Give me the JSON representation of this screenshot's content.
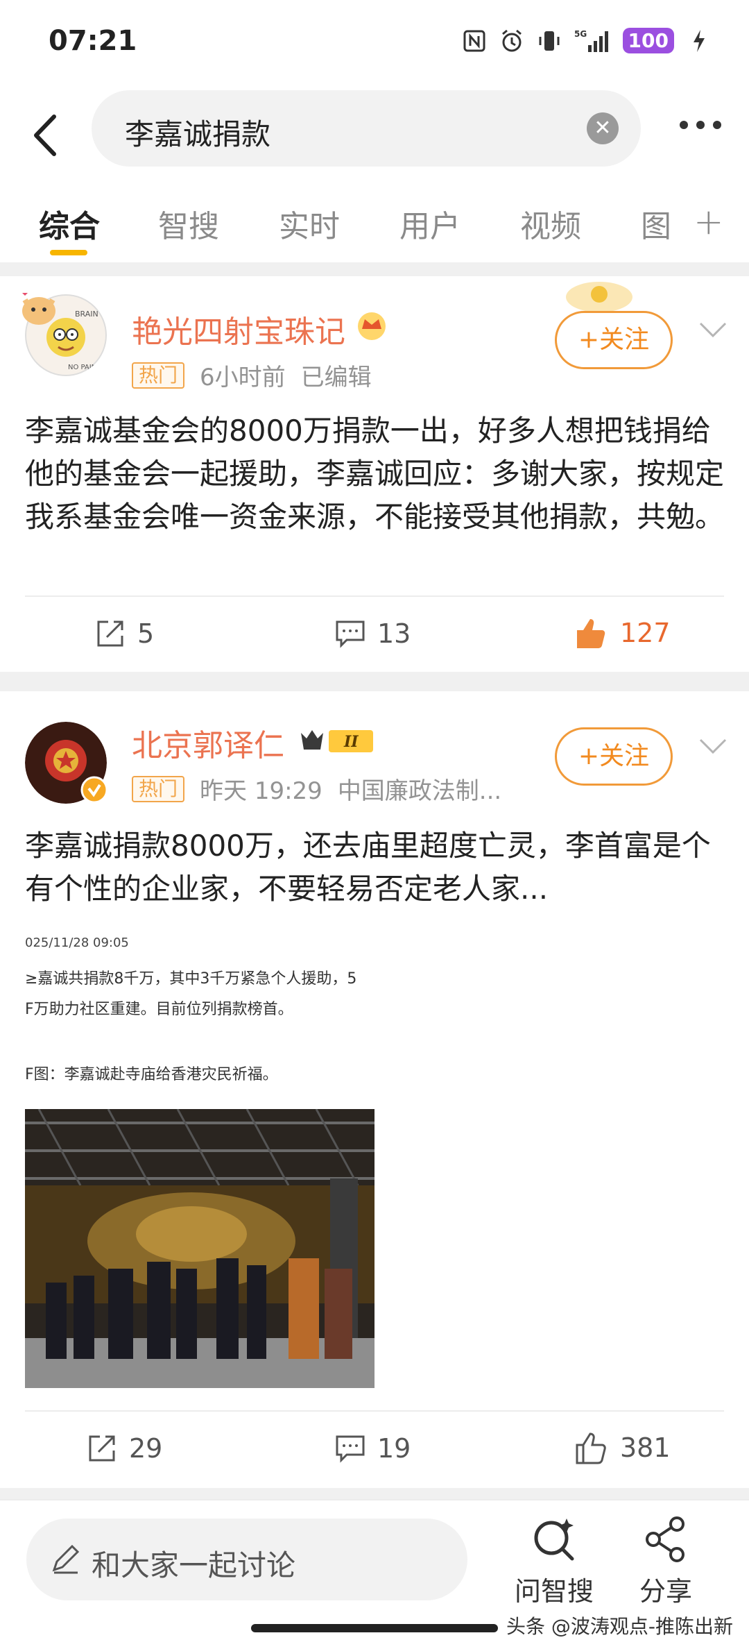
{
  "status_bar": {
    "time": "07:21",
    "network": "5G",
    "battery": "100"
  },
  "search": {
    "query": "李嘉诚捐款"
  },
  "tabs": [
    {
      "label": "综合",
      "active": true
    },
    {
      "label": "智搜",
      "active": false
    },
    {
      "label": "实时",
      "active": false
    },
    {
      "label": "用户",
      "active": false
    },
    {
      "label": "视频",
      "active": false
    },
    {
      "label": "图",
      "active": false
    }
  ],
  "posts": [
    {
      "author": "艳光四射宝珠记",
      "badge": "热门",
      "time": "6小时前",
      "edited": "已编辑",
      "follow_label": "+关注",
      "text": "李嘉诚基金会的8000万捐款一出，好多人想把钱捐给他的基金会一起援助，李嘉诚回应：多谢大家，按规定我系基金会唯一资金来源，不能接受其他捐款，共勉。",
      "reposts": "5",
      "comments": "13",
      "likes": "127",
      "liked": true
    },
    {
      "author": "北京郭译仁",
      "level_badge": "II",
      "badge": "热门",
      "time": "昨天 19:29",
      "source": "中国廉政法制...",
      "follow_label": "+关注",
      "text": "李嘉诚捐款8000万，还去庙里超度亡灵，李首富是个有个性的企业家，不要轻易否定老人家...",
      "embed_lines": [
        "025/11/28 09:05",
        "≥嘉诚共捐款8千万，其中3千万紧急个人援助，5",
        "F万助力社区重建。目前位列捐款榜首。",
        "F图：李嘉诚赴寺庙给香港灾民祈福。"
      ],
      "reposts": "29",
      "comments": "19",
      "likes": "381",
      "liked": false
    }
  ],
  "bottom_bar": {
    "comment_placeholder": "和大家一起讨论",
    "smart_search_label": "问智搜",
    "share_label": "分享"
  },
  "watermark": "头条 @波涛观点-推陈出新",
  "colors": {
    "accent": "#f7b500",
    "author": "#eb7350",
    "follow": "#f28a1f",
    "liked": "#e8682e"
  }
}
